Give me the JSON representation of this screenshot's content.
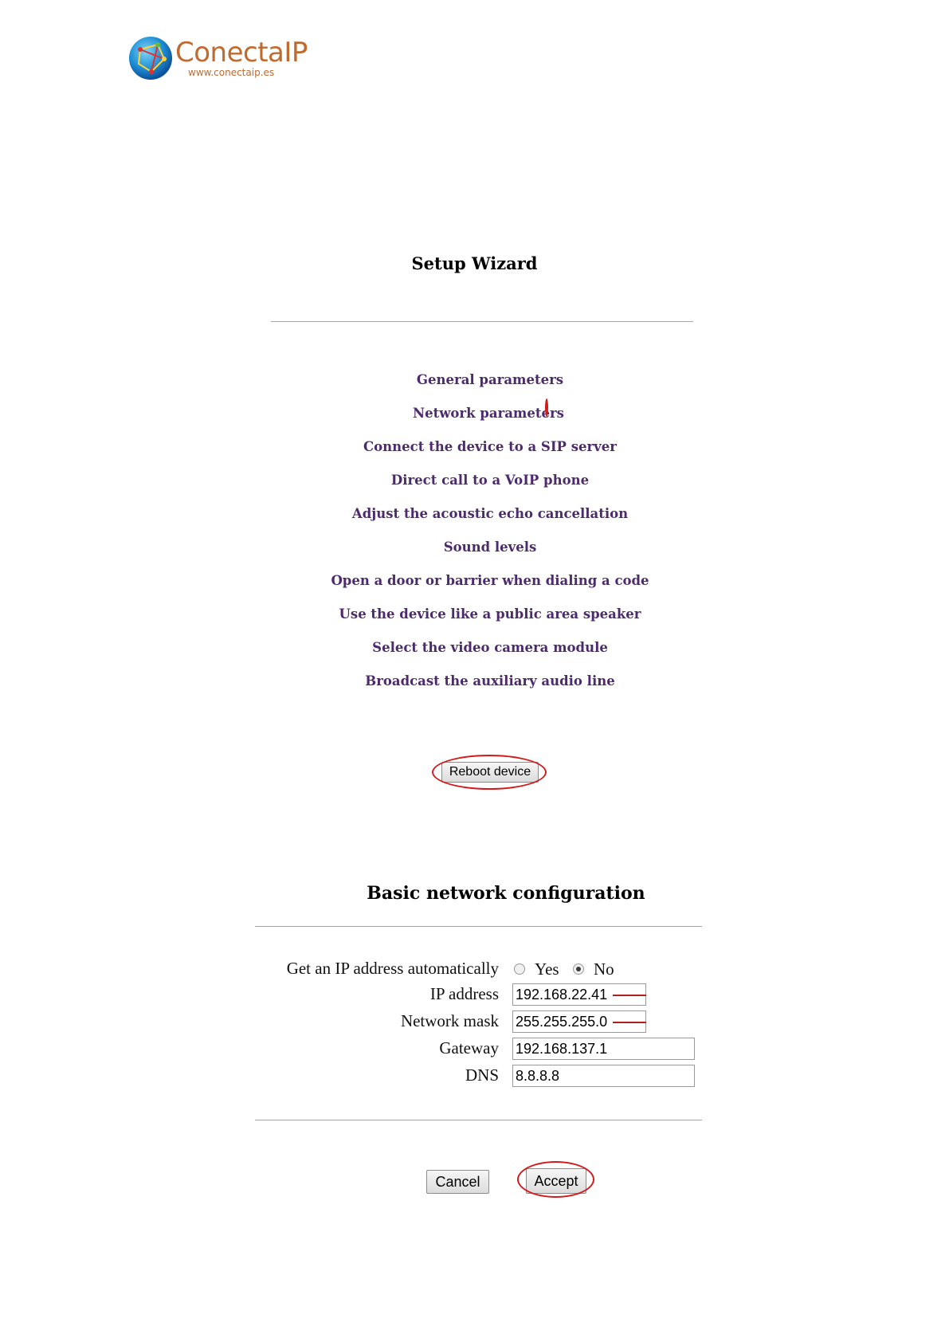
{
  "logo": {
    "name": "ConectaIP",
    "url": "www.conectaip.es"
  },
  "wizard": {
    "title": "Setup Wizard",
    "items": [
      "General parameters",
      "Network parameters",
      "Connect the device to a SIP server",
      "Direct call to a VoIP phone",
      "Adjust the acoustic echo cancellation",
      "Sound levels",
      "Open a door or barrier when dialing a code",
      "Use the device like a public area speaker",
      "Select the video camera module",
      "Broadcast the auxiliary audio line"
    ],
    "reboot_label": "Reboot device"
  },
  "network": {
    "title": "Basic network configuration",
    "auto_ip_label": "Get an IP address automatically",
    "yes_label": "Yes",
    "no_label": "No",
    "auto_ip_selected": "No",
    "fields": [
      {
        "label": "IP address",
        "value": "192.168.22.41"
      },
      {
        "label": "Network mask",
        "value": "255.255.255.0"
      },
      {
        "label": "Gateway",
        "value": "192.168.137.1"
      },
      {
        "label": "DNS",
        "value": "8.8.8.8"
      }
    ],
    "cancel_label": "Cancel",
    "accept_label": "Accept"
  },
  "colors": {
    "brand": "#c06a2f",
    "link": "#4d2a6e",
    "highlight": "#d21c1c"
  }
}
